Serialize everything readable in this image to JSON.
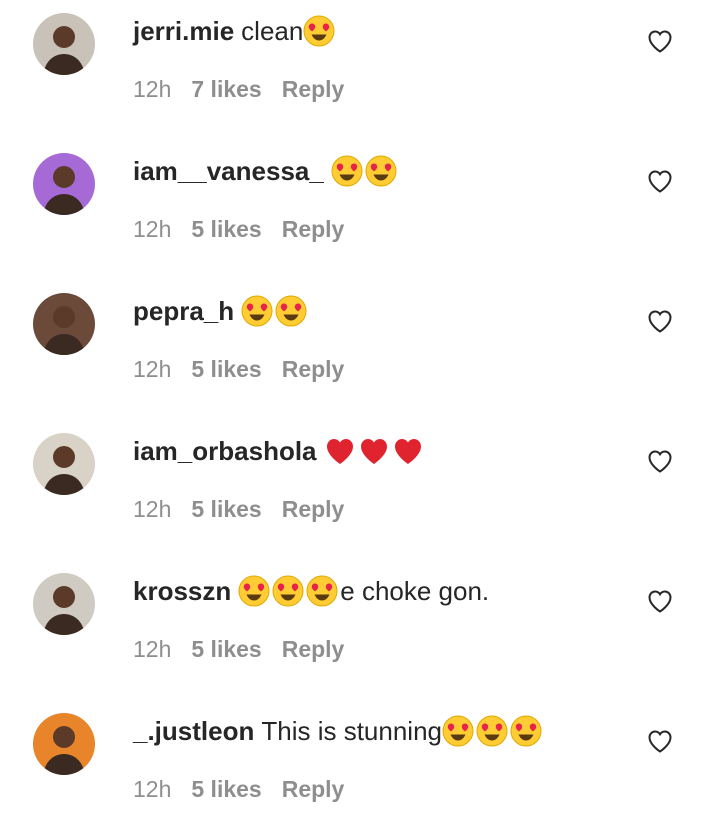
{
  "comments": [
    {
      "username": "jerri.mie",
      "emojis_before": [],
      "text": "clean",
      "emojis_after": [
        "heart-eyes"
      ],
      "time": "12h",
      "likes": "7 likes",
      "reply": "Reply",
      "avatar_color": "#c9c2b8"
    },
    {
      "username": "iam__vanessa_",
      "emojis_before": [
        "heart-eyes",
        "heart-eyes"
      ],
      "text": "",
      "emojis_after": [],
      "time": "12h",
      "likes": "5 likes",
      "reply": "Reply",
      "avatar_color": "#a56ad6"
    },
    {
      "username": "pepra_h",
      "emojis_before": [
        "heart-eyes",
        "heart-eyes"
      ],
      "text": "",
      "emojis_after": [],
      "time": "12h",
      "likes": "5 likes",
      "reply": "Reply",
      "avatar_color": "#6b4a3a"
    },
    {
      "username": "iam_orbashola",
      "emojis_before": [
        "red-heart",
        "red-heart",
        "red-heart"
      ],
      "text": "",
      "emojis_after": [],
      "time": "12h",
      "likes": "5 likes",
      "reply": "Reply",
      "avatar_color": "#d9d2c7"
    },
    {
      "username": "krosszn",
      "emojis_before": [
        "heart-eyes",
        "heart-eyes",
        "heart-eyes"
      ],
      "text": "e choke gon.",
      "emojis_after": [],
      "time": "12h",
      "likes": "5 likes",
      "reply": "Reply",
      "avatar_color": "#cfcac2"
    },
    {
      "username": "_.justleon",
      "emojis_before": [],
      "text": "This is stunning",
      "emojis_after": [
        "heart-eyes",
        "heart-eyes",
        "heart-eyes"
      ],
      "time": "12h",
      "likes": "5 likes",
      "reply": "Reply",
      "avatar_color": "#e8842a"
    }
  ],
  "like_icon": "heart-outline-icon"
}
